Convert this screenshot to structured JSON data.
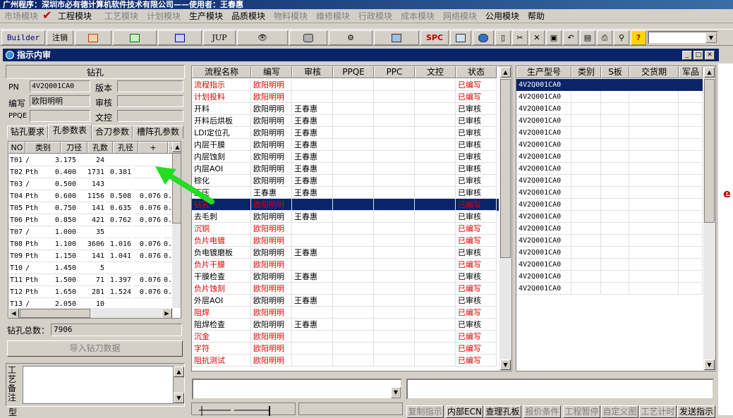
{
  "app_title": "广州程序：深圳市必有德计算机软件技术有限公司——使用者：王春惠",
  "menu": [
    {
      "label": "市场模块",
      "dim": true
    },
    {
      "label": "工程模块",
      "dim": false
    },
    {
      "label": "工艺模块",
      "dim": true
    },
    {
      "label": "计划模块",
      "dim": true
    },
    {
      "label": "生产模块",
      "dim": false
    },
    {
      "label": "品质模块",
      "dim": false
    },
    {
      "label": "物料模块",
      "dim": true
    },
    {
      "label": "维修模块",
      "dim": true
    },
    {
      "label": "行政模块",
      "dim": true
    },
    {
      "label": "成本模块",
      "dim": true
    },
    {
      "label": "网络模块",
      "dim": true
    },
    {
      "label": "公用模块",
      "dim": false
    },
    {
      "label": "帮助",
      "dim": false
    }
  ],
  "toolbar": {
    "builder": "Builder",
    "logout": "注销",
    "jup": "JUP",
    "spc": "SPC"
  },
  "window_title": "指示内审",
  "drill": {
    "header": "钻孔",
    "pn_label": "PN",
    "pn_value": "4V2Q001CA0",
    "version_label": "版本",
    "version_value": "",
    "author_label": "编写",
    "author_value": "欧阳明明",
    "review_label": "审核",
    "review_value": "",
    "ppqe_label": "PPQE",
    "ppqe_value": "",
    "doc_label": "文控",
    "doc_value": ""
  },
  "tabs": [
    "钻孔要求",
    "孔参数表",
    "合刀参数",
    "槽阵孔参数"
  ],
  "tool_table": {
    "headers": [
      "NO",
      "类别",
      "刀径",
      "孔数",
      "孔径",
      "+",
      "-"
    ],
    "rows": [
      [
        "T01",
        "/",
        "3.175",
        "24",
        "",
        "",
        ""
      ],
      [
        "T02",
        "Pth",
        "0.400",
        "1731",
        "0.381",
        "",
        ""
      ],
      [
        "T03",
        "/",
        "0.500",
        "143",
        "",
        "",
        ""
      ],
      [
        "T04",
        "Pth",
        "0.600",
        "1156",
        "0.508",
        "0.076",
        "0."
      ],
      [
        "T05",
        "Pth",
        "0.750",
        "141",
        "0.635",
        "0.076",
        "0."
      ],
      [
        "T06",
        "Pth",
        "0.850",
        "421",
        "0.762",
        "0.076",
        "0."
      ],
      [
        "T07",
        "/",
        "1.000",
        "35",
        "",
        "",
        ""
      ],
      [
        "T08",
        "Pth",
        "1.100",
        "3606",
        "1.016",
        "0.076",
        "0."
      ],
      [
        "T09",
        "Pth",
        "1.150",
        "141",
        "1.041",
        "0.076",
        "0."
      ],
      [
        "T10",
        "/",
        "1.450",
        "5",
        "",
        "",
        ""
      ],
      [
        "T11",
        "Pth",
        "1.500",
        "71",
        "1.397",
        "0.076",
        "0."
      ],
      [
        "T12",
        "Pth",
        "1.650",
        "281",
        "1.524",
        "0.076",
        "0."
      ],
      [
        "T13",
        "/",
        "2.050",
        "10",
        "",
        "",
        ""
      ]
    ]
  },
  "total_label": "钻孔总数：",
  "total_value": "7906",
  "import_button": "导入钻刀数据",
  "remark_label": "工艺备注",
  "remark_label2": "型",
  "process_table": {
    "headers": [
      "流程名称",
      "编写",
      "审核",
      "PPQE",
      "PPC",
      "文控",
      "状态"
    ],
    "rows": [
      {
        "name": "流程指示",
        "author": "欧阳明明",
        "review": "",
        "status": "已编写",
        "red": true
      },
      {
        "name": "计划投料",
        "author": "欧阳明明",
        "review": "",
        "status": "已编写",
        "red": true
      },
      {
        "name": "开料",
        "author": "欧阳明明",
        "review": "王春惠",
        "status": "已审核",
        "red": false
      },
      {
        "name": "开料后烘板",
        "author": "欧阳明明",
        "review": "王春惠",
        "status": "已审核",
        "red": false
      },
      {
        "name": "LDI定位孔",
        "author": "欧阳明明",
        "review": "王春惠",
        "status": "已审核",
        "red": false
      },
      {
        "name": "内层干膜",
        "author": "欧阳明明",
        "review": "王春惠",
        "status": "已审核",
        "red": false
      },
      {
        "name": "内层蚀刻",
        "author": "欧阳明明",
        "review": "王春惠",
        "status": "已审核",
        "red": false
      },
      {
        "name": "内层AOI",
        "author": "欧阳明明",
        "review": "王春惠",
        "status": "已审核",
        "red": false
      },
      {
        "name": "棕化",
        "author": "欧阳明明",
        "review": "王春惠",
        "status": "已审核",
        "red": false
      },
      {
        "name": "压压",
        "author": "王春惠",
        "review": "王春惠",
        "status": "已审核",
        "red": false
      },
      {
        "name": "钻孔",
        "author": "欧阳明明",
        "review": "",
        "status": "已编写",
        "red": true,
        "selected": true
      },
      {
        "name": "去毛刺",
        "author": "欧阳明明",
        "review": "王春惠",
        "status": "已审核",
        "red": false
      },
      {
        "name": "沉铜",
        "author": "欧阳明明",
        "review": "",
        "status": "已编写",
        "red": true
      },
      {
        "name": "负片电镀",
        "author": "欧阳明明",
        "review": "",
        "status": "已编写",
        "red": true
      },
      {
        "name": "负电镀磨板",
        "author": "欧阳明明",
        "review": "王春惠",
        "status": "已审核",
        "red": false
      },
      {
        "name": "负片干膜",
        "author": "欧阳明明",
        "review": "",
        "status": "已编写",
        "red": true
      },
      {
        "name": "干膜检查",
        "author": "欧阳明明",
        "review": "王春惠",
        "status": "已审核",
        "red": false
      },
      {
        "name": "负片蚀刻",
        "author": "欧阳明明",
        "review": "",
        "status": "已编写",
        "red": true
      },
      {
        "name": "外层AOI",
        "author": "欧阳明明",
        "review": "王春惠",
        "status": "已审核",
        "red": false
      },
      {
        "name": "阻焊",
        "author": "欧阳明明",
        "review": "",
        "status": "已编写",
        "red": true
      },
      {
        "name": "阻焊检查",
        "author": "欧阳明明",
        "review": "王春惠",
        "status": "已审核",
        "red": false
      },
      {
        "name": "沉金",
        "author": "欧阳明明",
        "review": "",
        "status": "已编写",
        "red": true
      },
      {
        "name": "字符",
        "author": "欧阳明明",
        "review": "",
        "status": "已编写",
        "red": true
      },
      {
        "name": "阻抗测试",
        "author": "欧阳明明",
        "review": "",
        "status": "已编写",
        "red": true
      }
    ]
  },
  "product_table": {
    "headers": [
      "生产型号",
      "类别",
      "S板",
      "交货期",
      "军品"
    ],
    "rows": [
      "4V2Q001CA0",
      "4V2Q001CA0",
      "4V2Q001CA0",
      "4V2Q001CA0",
      "4V2Q001CA0",
      "4V2Q001CA0",
      "4V2Q001CA0",
      "4V2Q001CA0",
      "4V2Q001CA0",
      "4V2Q001CA0",
      "4V2Q001CA0",
      "4V2Q001CA0",
      "4V2Q001CA0",
      "4V2Q001CA0",
      "4V2Q001CA0",
      "4V2Q001CA0",
      "4V2Q001CA0",
      "4V2Q001CA0"
    ]
  },
  "bottom_buttons": [
    {
      "label": "复制指示",
      "on": false
    },
    {
      "label": "内部ECN",
      "on": true
    },
    {
      "label": "查理孔板",
      "on": true
    },
    {
      "label": "报价条件",
      "on": false
    },
    {
      "label": "工程暂停",
      "on": false
    },
    {
      "label": "自定义图",
      "on": false
    },
    {
      "label": "工艺计时",
      "on": false
    },
    {
      "label": "发送指示",
      "on": true
    }
  ],
  "colors": {
    "title_bg": "#0a246a",
    "red_text": "#e00000",
    "face": "#d4d0c8",
    "arrow": "#22dd22"
  }
}
